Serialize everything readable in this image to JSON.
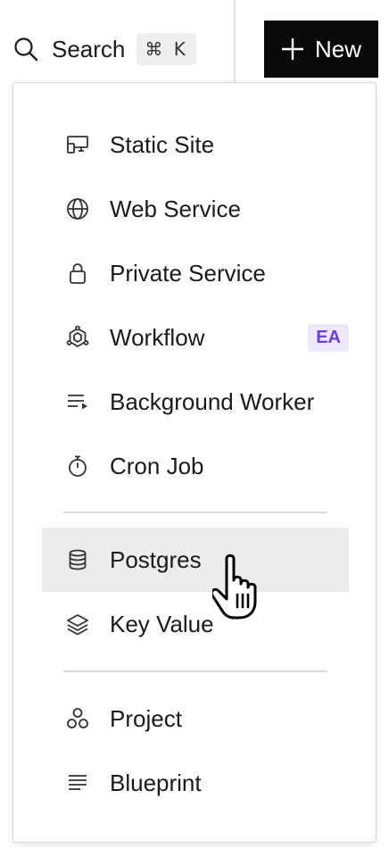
{
  "header": {
    "search_label": "Search",
    "search_shortcut": "⌘ K",
    "new_button_label": "New"
  },
  "menu": {
    "items": [
      {
        "label": "Static Site",
        "icon": "static-site-icon"
      },
      {
        "label": "Web Service",
        "icon": "globe-icon"
      },
      {
        "label": "Private Service",
        "icon": "lock-icon"
      },
      {
        "label": "Workflow",
        "icon": "workflow-icon",
        "badge": "EA"
      },
      {
        "label": "Background Worker",
        "icon": "list-arrow-icon"
      },
      {
        "label": "Cron Job",
        "icon": "stopwatch-icon"
      },
      {
        "label": "Postgres",
        "icon": "database-icon",
        "highlighted": true
      },
      {
        "label": "Key Value",
        "icon": "layers-icon"
      },
      {
        "label": "Project",
        "icon": "project-icon"
      },
      {
        "label": "Blueprint",
        "icon": "blueprint-icon"
      }
    ]
  },
  "colors": {
    "new_button_bg": "#0a0a0a",
    "badge_bg": "#ede7fb",
    "badge_text": "#6c3ce1",
    "hover_bg": "#ececec"
  }
}
